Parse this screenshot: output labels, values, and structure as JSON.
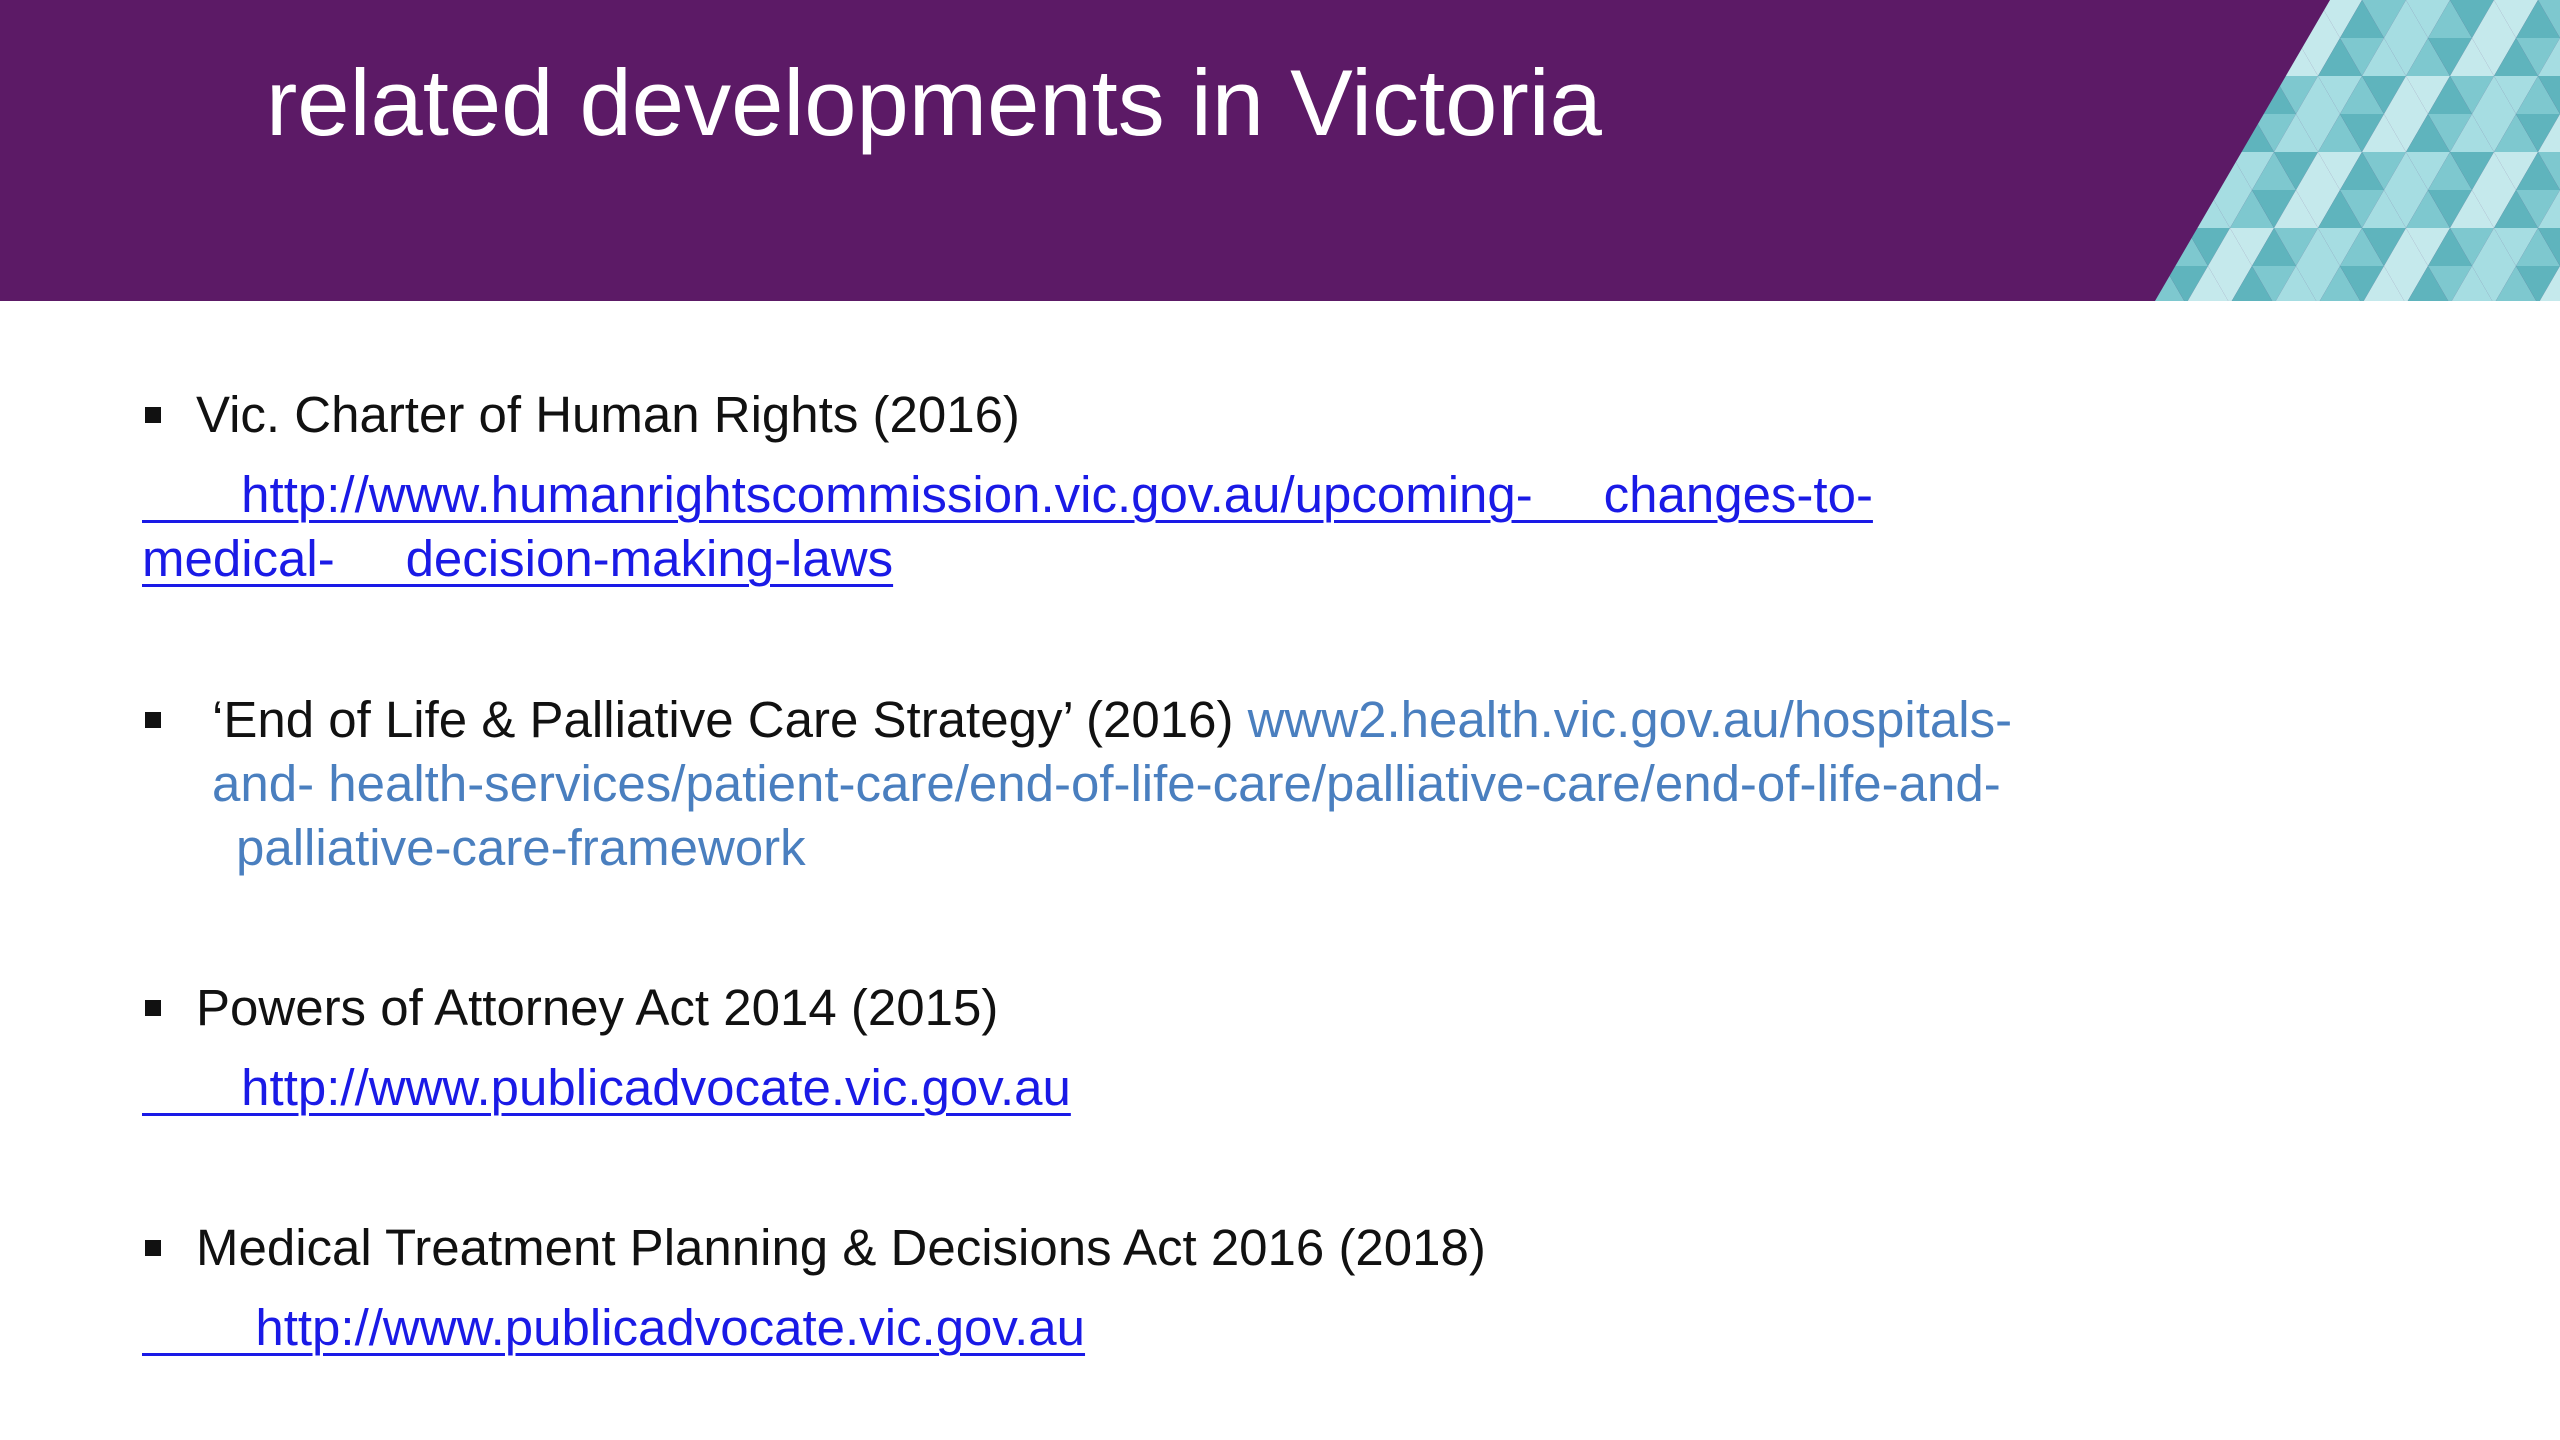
{
  "header": {
    "title": "related developments in Victoria",
    "background_color": "#5c1a66",
    "pattern_colors": [
      "#7ec8cf",
      "#a6dde2",
      "#5fb4bd",
      "#c5e9ec"
    ]
  },
  "items": [
    {
      "text": "Vic. Charter of Human Rights (2016)",
      "link_line_1": "       http://www.humanrightscommission.vic.gov.au/upcoming-     changes-to-",
      "link_line_2": "medical-     decision-making-laws"
    },
    {
      "text": "‘End of Life & Palliative Care Strategy’ (2016)",
      "inline_link": "www2.health.vic.gov.au/hospitals-",
      "link_line_2": "and- health-services/patient-care/end-of-life-care/palliative-care/end-of-life-and-",
      "link_line_3": "palliative-care-framework"
    },
    {
      "text": "Powers of Attorney Act 2014 (2015)",
      "link_line_1": "       http://www.publicadvocate.vic.gov.au"
    },
    {
      "text": "Medical Treatment Planning & Decisions Act 2016 (2018)",
      "link_line_1": "        http://www.publicadvocate.vic.gov.au"
    }
  ],
  "colors": {
    "link": "#1a1ae6",
    "soft_link": "#4a7fbf",
    "body_text": "#111111"
  }
}
